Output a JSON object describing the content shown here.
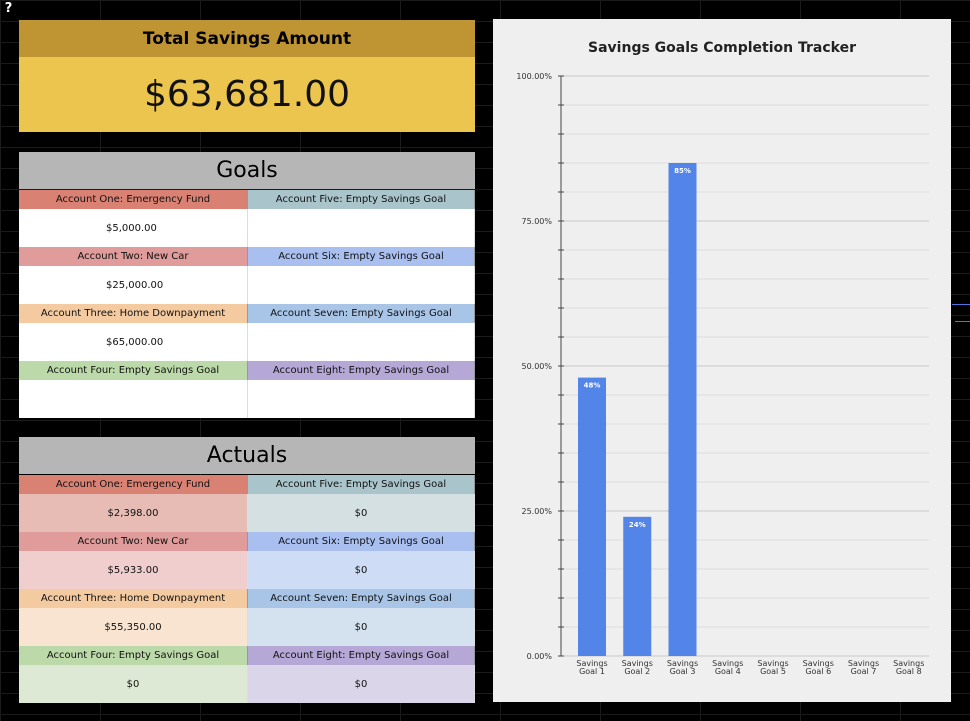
{
  "help": "?",
  "total": {
    "label": "Total Savings Amount",
    "value": "$63,681.00"
  },
  "goals": {
    "title": "Goals",
    "rows": [
      {
        "left": "Account One: Emergency Fund",
        "left_value": "$5,000.00",
        "right": "Account Five: Empty Savings Goal",
        "right_value": ""
      },
      {
        "left": "Account Two: New Car",
        "left_value": "$25,000.00",
        "right": "Account Six: Empty Savings Goal",
        "right_value": ""
      },
      {
        "left": "Account Three: Home Downpayment",
        "left_value": "$65,000.00",
        "right": "Account Seven: Empty Savings Goal",
        "right_value": ""
      },
      {
        "left": "Account Four: Empty Savings Goal",
        "left_value": "",
        "right": "Account Eight: Empty Savings Goal",
        "right_value": ""
      }
    ]
  },
  "actuals": {
    "title": "Actuals",
    "rows": [
      {
        "left": "Account One: Emergency Fund",
        "left_value": "$2,398.00",
        "right": "Account Five: Empty Savings Goal",
        "right_value": "$0"
      },
      {
        "left": "Account Two: New Car",
        "left_value": "$5,933.00",
        "right": "Account Six: Empty Savings Goal",
        "right_value": "$0"
      },
      {
        "left": "Account Three: Home Downpayment",
        "left_value": "$55,350.00",
        "right": "Account Seven: Empty Savings Goal",
        "right_value": "$0"
      },
      {
        "left": "Account Four: Empty Savings Goal",
        "left_value": "$0",
        "right": "Account Eight: Empty Savings Goal",
        "right_value": "$0"
      }
    ]
  },
  "colors": {
    "header_left": [
      "#d98173",
      "#e09b9b",
      "#f4cba0",
      "#bcd9a9"
    ],
    "header_right": [
      "#a9c4cb",
      "#a8bff0",
      "#a8c4e6",
      "#b5a7d6"
    ],
    "actual_left": [
      "#e6bcb5",
      "#f0cece",
      "#f9e4d2",
      "#dde9d5"
    ],
    "actual_right": [
      "#d5e0e3",
      "#cfdcf5",
      "#d4e1ef",
      "#dad5e9"
    ],
    "bar": "#5384e8"
  },
  "chart_data": {
    "type": "bar",
    "title": "Savings Goals Completion Tracker",
    "categories": [
      "Savings Goal 1",
      "Savings Goal 2",
      "Savings Goal 3",
      "Savings Goal 4",
      "Savings Goal 5",
      "Savings Goal 6",
      "Savings Goal 7",
      "Savings Goal 8"
    ],
    "values": [
      48,
      24,
      85,
      0,
      0,
      0,
      0,
      0
    ],
    "data_labels": [
      "48%",
      "24%",
      "85%",
      "",
      "",
      "",
      "",
      ""
    ],
    "y_ticks": [
      "0.00%",
      "25.00%",
      "50.00%",
      "75.00%",
      "100.00%"
    ],
    "ylim": [
      0,
      100
    ],
    "grid": true
  }
}
